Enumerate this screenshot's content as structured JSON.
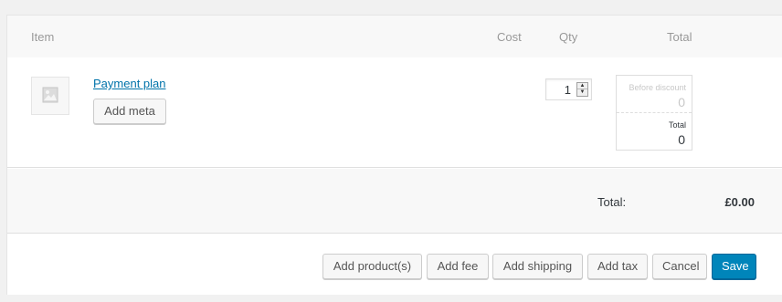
{
  "header": {
    "item": "Item",
    "cost": "Cost",
    "qty": "Qty",
    "total": "Total"
  },
  "line_item": {
    "thumbnail_icon": "image-placeholder-icon",
    "name": "Payment plan",
    "add_meta_label": "Add meta",
    "quantity": "1",
    "before_discount_label": "Before discount",
    "before_discount_value": "0",
    "total_label": "Total",
    "total_value": "0"
  },
  "summary": {
    "total_label": "Total:",
    "total_value": "£0.00"
  },
  "actions": {
    "add_products": "Add product(s)",
    "add_fee": "Add fee",
    "add_shipping": "Add shipping",
    "add_tax": "Add tax",
    "cancel": "Cancel",
    "save": "Save"
  },
  "colors": {
    "primary": "#0085ba",
    "link": "#0073aa",
    "header_bg": "#f8f8f8"
  }
}
